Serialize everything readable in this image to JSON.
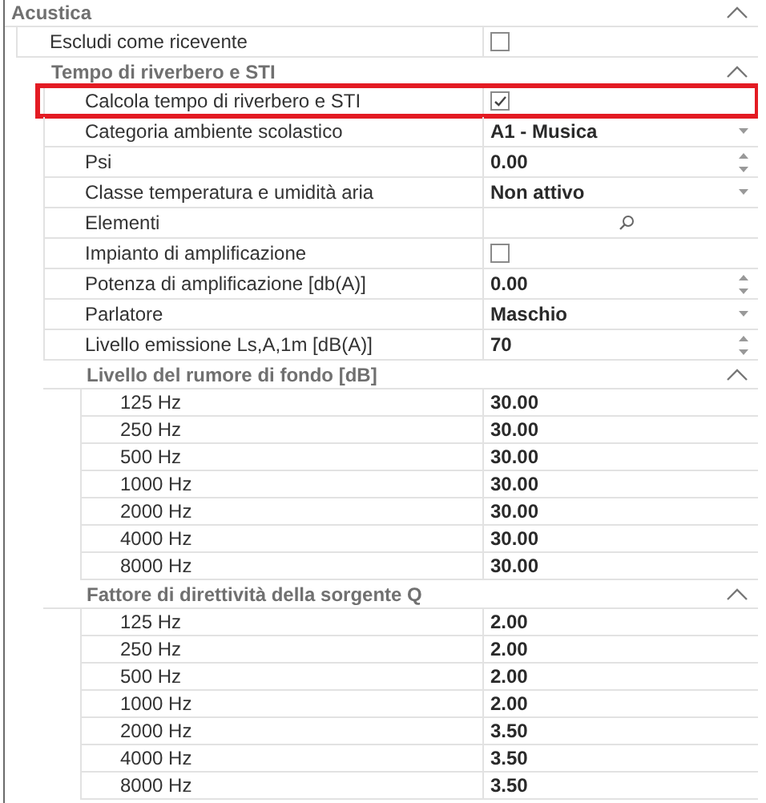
{
  "category": {
    "title": "Acustica",
    "expanded": true,
    "children": [
      {
        "kind": "checkbox",
        "label": "Escludi come ricevente",
        "checked": false
      },
      {
        "kind": "group",
        "title": "Tempo di riverbero e STI",
        "expanded": true,
        "children": [
          {
            "kind": "checkbox",
            "label": "Calcola tempo di riverbero e STI",
            "checked": true,
            "highlighted": true
          },
          {
            "kind": "dropdown",
            "label": "Categoria ambiente scolastico",
            "value": "A1 - Musica"
          },
          {
            "kind": "spinner",
            "label": "Psi",
            "value": "0.00"
          },
          {
            "kind": "dropdown",
            "label": "Classe temperatura e umidità aria",
            "value": "Non attivo"
          },
          {
            "kind": "search",
            "label": "Elementi"
          },
          {
            "kind": "checkbox",
            "label": "Impianto di amplificazione",
            "checked": false
          },
          {
            "kind": "spinner",
            "label": "Potenza di amplificazione [db(A)]",
            "value": "0.00"
          },
          {
            "kind": "dropdown",
            "label": "Parlatore",
            "value": "Maschio"
          },
          {
            "kind": "spinner",
            "label": "Livello emissione Ls,A,1m [dB(A)]",
            "value": "70"
          },
          {
            "kind": "group",
            "title": "Livello del rumore di fondo [dB]",
            "expanded": true,
            "children": [
              {
                "kind": "text",
                "label": "125 Hz",
                "value": "30.00"
              },
              {
                "kind": "text",
                "label": "250 Hz",
                "value": "30.00"
              },
              {
                "kind": "text",
                "label": "500 Hz",
                "value": "30.00"
              },
              {
                "kind": "text",
                "label": "1000 Hz",
                "value": "30.00"
              },
              {
                "kind": "text",
                "label": "2000 Hz",
                "value": "30.00"
              },
              {
                "kind": "text",
                "label": "4000 Hz",
                "value": "30.00"
              },
              {
                "kind": "text",
                "label": "8000 Hz",
                "value": "30.00"
              }
            ]
          },
          {
            "kind": "group",
            "title": "Fattore di direttività della sorgente Q",
            "expanded": true,
            "children": [
              {
                "kind": "text",
                "label": "125 Hz",
                "value": "2.00"
              },
              {
                "kind": "text",
                "label": "250 Hz",
                "value": "2.00"
              },
              {
                "kind": "text",
                "label": "500 Hz",
                "value": "2.00"
              },
              {
                "kind": "text",
                "label": "1000 Hz",
                "value": "2.00"
              },
              {
                "kind": "text",
                "label": "2000 Hz",
                "value": "3.50"
              },
              {
                "kind": "text",
                "label": "4000 Hz",
                "value": "3.50"
              },
              {
                "kind": "text",
                "label": "8000 Hz",
                "value": "3.50"
              }
            ]
          }
        ]
      }
    ]
  }
}
